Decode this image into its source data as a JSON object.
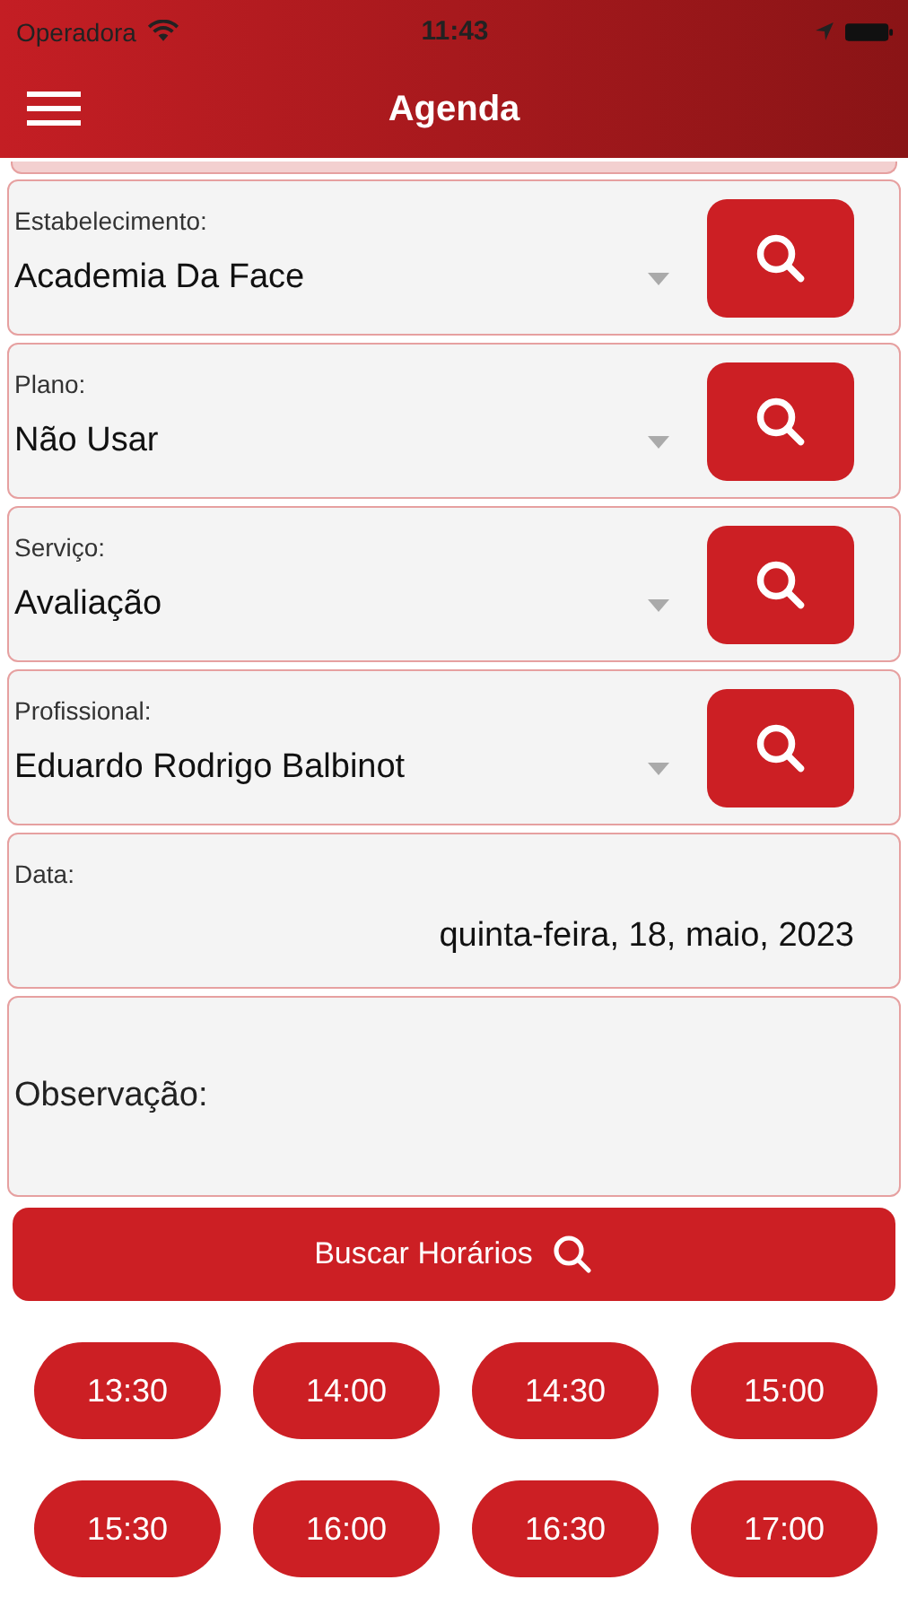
{
  "status_bar": {
    "carrier": "Operadora",
    "time": "11:43"
  },
  "nav": {
    "title": "Agenda"
  },
  "fields": [
    {
      "kind": "select",
      "label": "Estabelecimento:",
      "value": "Academia Da Face"
    },
    {
      "kind": "select",
      "label": "Plano:",
      "value": "Não Usar"
    },
    {
      "kind": "select",
      "label": "Serviço:",
      "value": "Avaliação"
    },
    {
      "kind": "select",
      "label": "Profissional:",
      "value": "Eduardo Rodrigo Balbinot"
    },
    {
      "kind": "date",
      "label": "Data:",
      "value": "quinta-feira, 18, maio, 2023"
    },
    {
      "kind": "note",
      "label": "Observação:"
    }
  ],
  "search_button": {
    "label": "Buscar Horários"
  },
  "time_slots": [
    "13:30",
    "14:00",
    "14:30",
    "15:00",
    "15:30",
    "16:00",
    "16:30",
    "17:00"
  ]
}
